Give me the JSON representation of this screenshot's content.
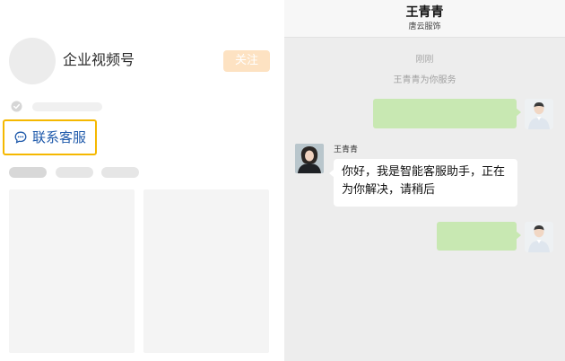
{
  "profile": {
    "channel_name": "企业视频号",
    "follow_label": "关注",
    "contact_label": "联系客服"
  },
  "chat": {
    "title": "王青青",
    "subtitle": "唐云服饰",
    "time": "刚刚",
    "service_note": "王青青为你服务",
    "agent_name": "王青青",
    "agent_message": "你好，我是智能客服助手，正在为你解决，请稍后"
  },
  "colors": {
    "contact_highlight": "#f5b800",
    "contact_text": "#1f5aab",
    "follow_button": "#fde2c2",
    "user_bubble": "#c8e8b2",
    "chat_background": "#ededed"
  },
  "icons": {
    "verify": "verified-badge-icon",
    "contact": "chat-bubble-icon"
  }
}
